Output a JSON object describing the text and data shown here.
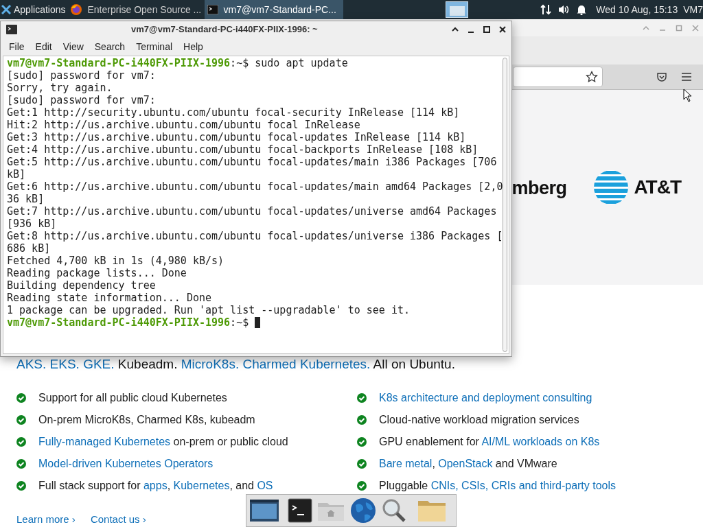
{
  "taskbar": {
    "apps_menu": "Applications",
    "tasks": [
      {
        "label": "Enterprise Open Source ...",
        "kind": "browser",
        "selected": false
      },
      {
        "label": "vm7@vm7-Standard-PC...",
        "kind": "terminal",
        "selected": true
      }
    ],
    "clock": "Wed 10 Aug, 15:13",
    "user": "VM7"
  },
  "terminal": {
    "title": "vm7@vm7-Standard-PC-i440FX-PIIX-1996: ~",
    "menu": [
      "File",
      "Edit",
      "View",
      "Search",
      "Terminal",
      "Help"
    ],
    "lines": [
      {
        "prompt": "vm7@vm7-Standard-PC-i440FX-PIIX-1996",
        "text": ":~$ sudo apt update",
        "cursor": false
      },
      {
        "text": "[sudo] password for vm7:",
        "cursor": false
      },
      {
        "text": "Sorry, try again.",
        "cursor": false
      },
      {
        "text": "[sudo] password for vm7:",
        "cursor": false
      },
      {
        "text": "Get:1 http://security.ubuntu.com/ubuntu focal-security InRelease [114 kB]",
        "cursor": false
      },
      {
        "text": "Hit:2 http://us.archive.ubuntu.com/ubuntu focal InRelease",
        "cursor": false
      },
      {
        "text": "Get:3 http://us.archive.ubuntu.com/ubuntu focal-updates InRelease [114 kB]",
        "cursor": false
      },
      {
        "text": "Get:4 http://us.archive.ubuntu.com/ubuntu focal-backports InRelease [108 kB]",
        "cursor": false
      },
      {
        "text": "Get:5 http://us.archive.ubuntu.com/ubuntu focal-updates/main i386 Packages [706",
        "cursor": false
      },
      {
        "text": "kB]",
        "cursor": false
      },
      {
        "text": "Get:6 http://us.archive.ubuntu.com/ubuntu focal-updates/main amd64 Packages [2,0",
        "cursor": false
      },
      {
        "text": "36 kB]",
        "cursor": false
      },
      {
        "text": "Get:7 http://us.archive.ubuntu.com/ubuntu focal-updates/universe amd64 Packages",
        "cursor": false
      },
      {
        "text": "[936 kB]",
        "cursor": false
      },
      {
        "text": "Get:8 http://us.archive.ubuntu.com/ubuntu focal-updates/universe i386 Packages [",
        "cursor": false
      },
      {
        "text": "686 kB]",
        "cursor": false
      },
      {
        "text": "Fetched 4,700 kB in 1s (4,980 kB/s)",
        "cursor": false
      },
      {
        "text": "Reading package lists... Done",
        "cursor": false
      },
      {
        "text": "Building dependency tree",
        "cursor": false
      },
      {
        "text": "Reading state information... Done",
        "cursor": false
      },
      {
        "text": "1 package can be upgraded. Run 'apt list --upgradable' to see it.",
        "cursor": false
      },
      {
        "prompt": "vm7@vm7-Standard-PC-i440FX-PIIX-1996",
        "text": ":~$ ",
        "cursor": true
      }
    ]
  },
  "browser": {
    "logos": [
      "mberg",
      "AT&T"
    ],
    "headline": [
      {
        "text": "AKS. EKS. GKE.",
        "link": true
      },
      {
        "text": " Kubeadm. ",
        "link": false
      },
      {
        "text": "MicroK8s. Charmed Kubernetes.",
        "link": true
      },
      {
        "text": " All on Ubuntu.",
        "link": false
      }
    ],
    "feature_columns": [
      [
        [
          {
            "text": "Support for all public cloud Kubernetes",
            "link": false
          }
        ],
        [
          {
            "text": "On-prem MicroK8s, Charmed K8s, kubeadm",
            "link": false
          }
        ],
        [
          {
            "text": "Fully-managed Kubernetes",
            "link": true
          },
          {
            "text": " on-prem or public cloud",
            "link": false
          }
        ],
        [
          {
            "text": "Model-driven Kubernetes Operators",
            "link": true
          }
        ],
        [
          {
            "text": "Full stack support for ",
            "link": false
          },
          {
            "text": "apps",
            "link": true
          },
          {
            "text": ", ",
            "link": false
          },
          {
            "text": "Kubernetes",
            "link": true
          },
          {
            "text": ", and ",
            "link": false
          },
          {
            "text": "OS",
            "link": true
          }
        ]
      ],
      [
        [
          {
            "text": "K8s architecture and deployment consulting",
            "link": true
          }
        ],
        [
          {
            "text": "Cloud-native workload migration services",
            "link": false
          }
        ],
        [
          {
            "text": "GPU enablement for ",
            "link": false
          },
          {
            "text": "AI/ML workloads on K8s",
            "link": true
          }
        ],
        [
          {
            "text": "Bare metal",
            "link": true
          },
          {
            "text": ", ",
            "link": false
          },
          {
            "text": "OpenStack",
            "link": true
          },
          {
            "text": " and VMware",
            "link": false
          }
        ],
        [
          {
            "text": "Pluggable ",
            "link": false
          },
          {
            "text": "CNIs, CSIs, CRIs and third-party tools",
            "link": true
          }
        ]
      ]
    ],
    "links": [
      "Learn more ›",
      "Contact us ›"
    ]
  }
}
